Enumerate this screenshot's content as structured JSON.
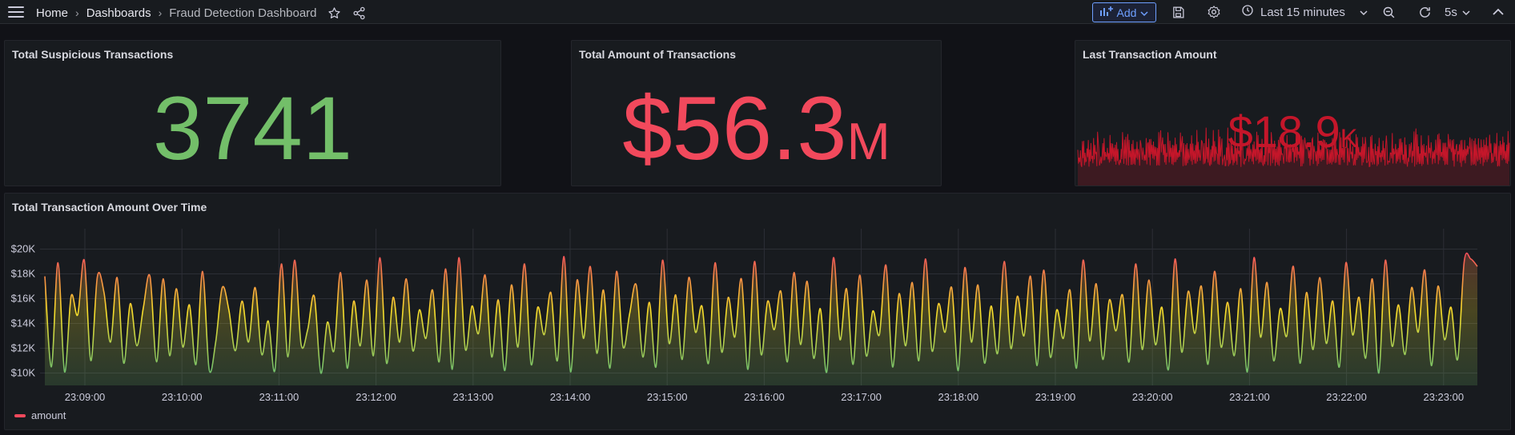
{
  "nav": {
    "home": "Home",
    "dashboards": "Dashboards",
    "current": "Fraud Detection Dashboard",
    "separator": "›",
    "icons": [
      "menu-icon",
      "star-icon",
      "share-icon"
    ]
  },
  "toolbar": {
    "add_label": "Add",
    "time_range": "Last 15 minutes",
    "refresh_interval": "5s",
    "icons": [
      "add-panel-icon",
      "save-icon",
      "settings-icon",
      "clock-icon",
      "zoom-out-icon",
      "refresh-icon",
      "collapse-icon"
    ]
  },
  "colors": {
    "background": "#111217",
    "panel": "#181b1f",
    "green": "#73bf69",
    "red": "#f2495c",
    "dark_red": "#c4162a",
    "blue": "#6e9fff",
    "yellow": "#fade2a"
  },
  "panels": {
    "suspicious": {
      "title": "Total Suspicious Transactions",
      "value": "3741",
      "unit": "",
      "color": "#73bf69"
    },
    "total_amount": {
      "title": "Total Amount of Transactions",
      "value": "$56.3",
      "unit": "M",
      "color": "#f2495c"
    },
    "last_amount": {
      "title": "Last Transaction Amount",
      "value": "$18.9",
      "unit": "K",
      "color": "#c4162a"
    },
    "timeseries": {
      "title": "Total Transaction Amount Over Time",
      "legend": "amount"
    }
  },
  "chart_data": {
    "type": "area",
    "title": "Total Transaction Amount Over Time",
    "ylabel": "",
    "xlabel": "",
    "ylim": [
      9000,
      21000
    ],
    "yticks": [
      "$10K",
      "$12K",
      "$14K",
      "$16K",
      "$18K",
      "$20K"
    ],
    "xticks": [
      "23:09:00",
      "23:10:00",
      "23:11:00",
      "23:12:00",
      "23:13:00",
      "23:14:00",
      "23:15:00",
      "23:16:00",
      "23:17:00",
      "23:18:00",
      "23:19:00",
      "23:20:00",
      "23:21:00",
      "23:22:00",
      "23:23:00"
    ],
    "legend": "bottom-left",
    "grid": true,
    "gradient": [
      "#73bf69",
      "#fade2a",
      "#f2495c"
    ],
    "series": [
      {
        "name": "amount",
        "values": [
          17800,
          10500,
          18900,
          10100,
          16200,
          14700,
          19100,
          11000,
          17800,
          16500,
          12500,
          17700,
          10800,
          15600,
          12200,
          15300,
          17800,
          10900,
          17600,
          11400,
          16800,
          12100,
          15500,
          10700,
          18200,
          10300,
          12500,
          16900,
          15100,
          11800,
          15800,
          12500,
          16900,
          11500,
          14200,
          10200,
          18800,
          11300,
          19100,
          12300,
          13500,
          16200,
          10000,
          14100,
          11800,
          18100,
          10400,
          15800,
          12200,
          17500,
          11400,
          19300,
          10800,
          16100,
          12500,
          17600,
          11800,
          15100,
          12800,
          16700,
          10900,
          18400,
          10300,
          19300,
          11900,
          15400,
          13200,
          17900,
          11300,
          15900,
          10200,
          17100,
          12100,
          18800,
          10700,
          15300,
          13100,
          16500,
          11000,
          19400,
          10100,
          17500,
          12800,
          18600,
          11600,
          16700,
          10400,
          18200,
          12100,
          14800,
          17100,
          11300,
          15700,
          10500,
          19100,
          12400,
          16300,
          11100,
          17700,
          13300,
          15400,
          10800,
          18900,
          11700,
          16100,
          12900,
          17600,
          10300,
          19000,
          11500,
          15800,
          13500,
          16600,
          10900,
          18100,
          12300,
          17400,
          11200,
          15200,
          10100,
          19300,
          12700,
          16800,
          10700,
          17900,
          11400,
          15000,
          13100,
          18700,
          10500,
          16400,
          12200,
          17300,
          11000,
          19200,
          11800,
          15600,
          13300,
          16900,
          10200,
          18500,
          12500,
          17100,
          10800,
          15400,
          11600,
          19000,
          12000,
          16200,
          13000,
          17800,
          10600,
          18300,
          11300,
          15100,
          12800,
          16700,
          10400,
          19100,
          12600,
          17200,
          11100,
          15900,
          13400,
          16300,
          10900,
          18800,
          11900,
          17500,
          12300,
          15300,
          10300,
          19200,
          11700,
          16600,
          13200,
          17000,
          10700,
          18200,
          12100,
          15700,
          11400,
          16800,
          10100,
          19300,
          12900,
          17300,
          11000,
          15200,
          13000,
          18600,
          10800,
          16500,
          11900,
          17700,
          12400,
          15800,
          10500,
          18900,
          13100,
          16100,
          11200,
          17600,
          10000,
          19100,
          12200,
          15500,
          11500,
          16900,
          13300,
          18300,
          10600,
          17000,
          12700,
          15300,
          11100,
          19000,
          19200,
          18600
        ]
      }
    ]
  }
}
